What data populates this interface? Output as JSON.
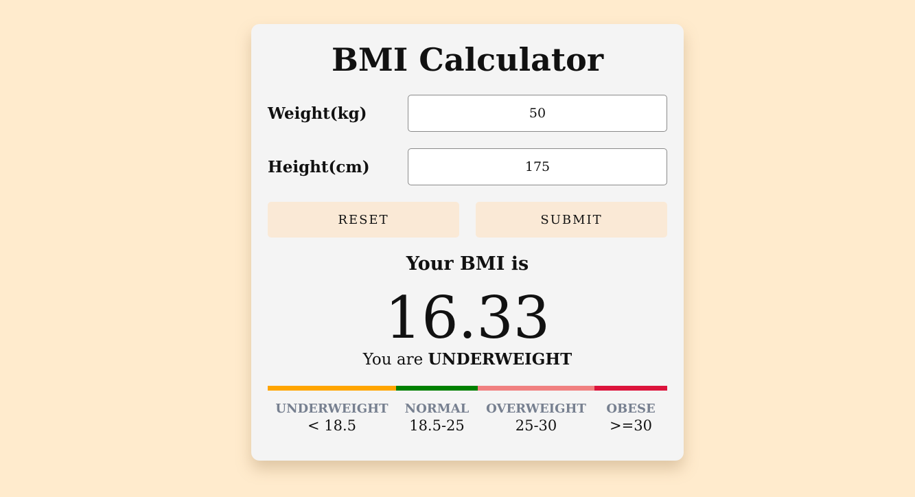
{
  "title": "BMI Calculator",
  "form": {
    "weight_label": "Weight(kg)",
    "weight_value": "50",
    "height_label": "Height(cm)",
    "height_value": "175"
  },
  "buttons": {
    "reset_label": "RESET",
    "submit_label": "SUBMIT"
  },
  "result": {
    "heading": "Your BMI is",
    "value": "16.33",
    "status_prefix": "You are",
    "status_category": "UNDERWEIGHT"
  },
  "scale": [
    {
      "name": "UNDERWEIGHT",
      "range": "< 18.5",
      "color": "#ffa500"
    },
    {
      "name": "NORMAL",
      "range": "18.5-25",
      "color": "#008000"
    },
    {
      "name": "OVERWEIGHT",
      "range": "25-30",
      "color": "#f08080"
    },
    {
      "name": "OBESE",
      "range": ">=30",
      "color": "#dc143c"
    }
  ],
  "colors": {
    "background": "#ffebcd",
    "card": "#f4f4f4",
    "button": "#fae9d6",
    "legend_label": "#778090"
  }
}
